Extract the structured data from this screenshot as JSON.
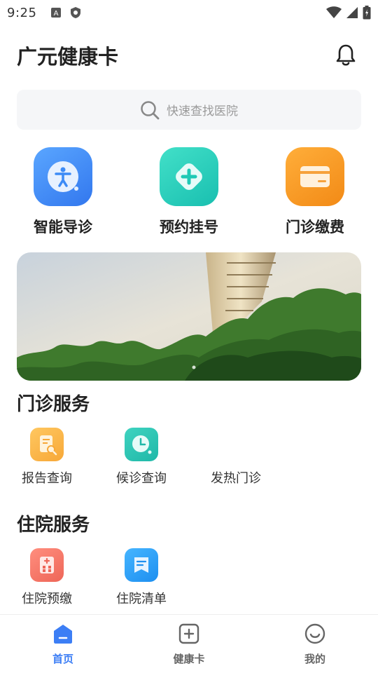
{
  "status": {
    "time": "9:25"
  },
  "header": {
    "title": "广元健康卡"
  },
  "search": {
    "placeholder": "快速查找医院"
  },
  "quick_actions": [
    {
      "label": "智能导诊",
      "icon": "accessibility-icon",
      "color": "#3d8bf6"
    },
    {
      "label": "预约挂号",
      "icon": "medical-cross-icon",
      "color": "#1fc9b5"
    },
    {
      "label": "门诊缴费",
      "icon": "card-icon",
      "color": "#f6921e"
    }
  ],
  "outpatient": {
    "title": "门诊服务",
    "items": [
      {
        "label": "报告查询",
        "icon": "report-search-icon",
        "color": "#fbb246"
      },
      {
        "label": "候诊查询",
        "icon": "clock-icon",
        "color": "#28c6b4"
      },
      {
        "label": "发热门诊"
      }
    ]
  },
  "inpatient": {
    "title": "住院服务",
    "items": [
      {
        "label": "住院预缴",
        "icon": "hospital-icon",
        "color": "#f2766a"
      },
      {
        "label": "住院清单",
        "icon": "list-icon",
        "color": "#2ea2f5"
      }
    ]
  },
  "tabs": [
    {
      "label": "首页",
      "icon": "home-icon",
      "active": true
    },
    {
      "label": "健康卡",
      "icon": "add-card-icon",
      "active": false
    },
    {
      "label": "我的",
      "icon": "smile-icon",
      "active": false
    }
  ],
  "colors": {
    "active": "#3c7ef5",
    "inactive": "#666666"
  }
}
